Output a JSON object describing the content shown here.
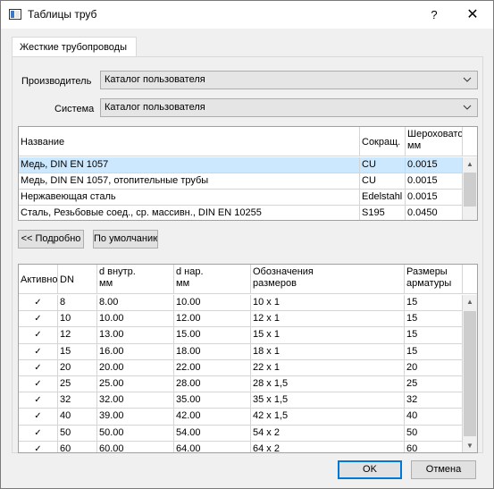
{
  "window": {
    "title": "Таблицы труб",
    "help_label": "?",
    "close_label": "✕"
  },
  "tab": {
    "label": "Жесткие трубопроводы"
  },
  "manufacturer": {
    "label": "Производитель",
    "value": "Каталог пользователя"
  },
  "system": {
    "label": "Система",
    "value": "Каталог пользователя"
  },
  "materials": {
    "headers": [
      "Название",
      "Сокращ.",
      "Шероховатость\nмм"
    ],
    "rows": [
      [
        "Медь, DIN EN 1057",
        "CU",
        "0.0015"
      ],
      [
        "Медь, DIN EN 1057, отопительные трубы",
        "CU",
        "0.0015"
      ],
      [
        "Нержавеющая сталь",
        "Edelstahl",
        "0.0015"
      ],
      [
        "Сталь, Резьбовые соед., ср. массивн., DIN EN 10255",
        "S195",
        "0.0450"
      ]
    ],
    "selected_row": 0
  },
  "buttons": {
    "details": "<< Подробно",
    "defaults": "По умолчанию",
    "ok": "OK",
    "cancel": "Отмена"
  },
  "sizes": {
    "headers": [
      "Активно",
      "DN",
      "d внутр.\nмм",
      "d нар.\nмм",
      "Обозначения\nразмеров",
      "Размеры\nарматуры"
    ],
    "rows": [
      [
        "✓",
        "8",
        "8.00",
        "10.00",
        "10 x 1",
        "15"
      ],
      [
        "✓",
        "10",
        "10.00",
        "12.00",
        "12 x 1",
        "15"
      ],
      [
        "✓",
        "12",
        "13.00",
        "15.00",
        "15 x 1",
        "15"
      ],
      [
        "✓",
        "15",
        "16.00",
        "18.00",
        "18 x 1",
        "15"
      ],
      [
        "✓",
        "20",
        "20.00",
        "22.00",
        "22 x 1",
        "20"
      ],
      [
        "✓",
        "25",
        "25.00",
        "28.00",
        "28 x 1,5",
        "25"
      ],
      [
        "✓",
        "32",
        "32.00",
        "35.00",
        "35 x 1,5",
        "32"
      ],
      [
        "✓",
        "40",
        "39.00",
        "42.00",
        "42 x 1,5",
        "40"
      ],
      [
        "✓",
        "50",
        "50.00",
        "54.00",
        "54 x 2",
        "50"
      ],
      [
        "✓",
        "60",
        "60.00",
        "64.00",
        "64 x 2",
        "60"
      ]
    ]
  },
  "icons": {
    "app": "window-app-icon",
    "combo_arrow": "chevron-down-icon",
    "check": "checkmark-icon"
  },
  "colors": {
    "selection": "#cce8ff",
    "accent": "#0078d7"
  }
}
